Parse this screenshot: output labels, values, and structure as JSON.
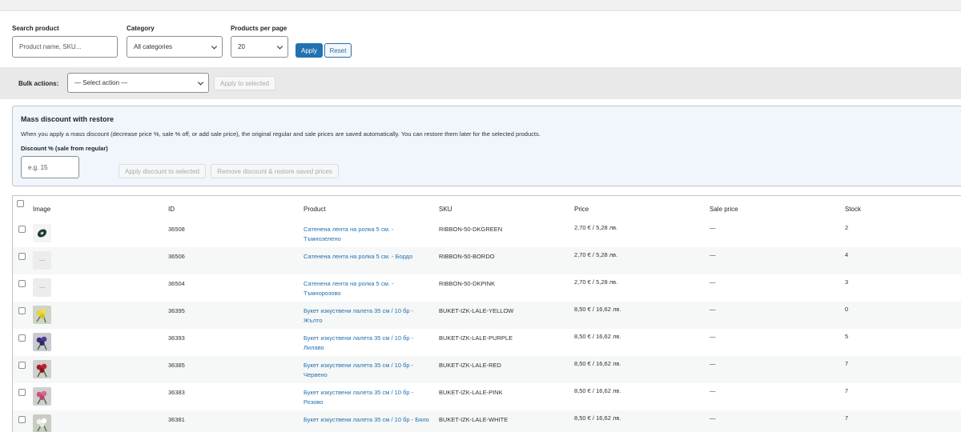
{
  "filters": {
    "search_label": "Search product",
    "search_placeholder": "Product name, SKU...",
    "category_label": "Category",
    "category_value": "All categories",
    "per_page_label": "Products per page",
    "per_page_value": "20",
    "apply_label": "Apply",
    "reset_label": "Reset"
  },
  "bulk": {
    "label": "Bulk actions:",
    "select_value": "— Select action —",
    "apply_label": "Apply to selected"
  },
  "discount": {
    "title": "Mass discount with restore",
    "description": "When you apply a mass discount (decrease price %, sale % off, or add sale price), the original regular and sale prices are saved automatically. You can restore them later for the selected products.",
    "field_label": "Discount % (sale from regular)",
    "field_placeholder": "e.g. 15",
    "apply_label": "Apply discount to selected",
    "remove_label": "Remove discount & restore saved prices"
  },
  "table": {
    "columns": [
      "Image",
      "ID",
      "Product",
      "SKU",
      "Price",
      "Sale price",
      "Stock"
    ],
    "rows": [
      {
        "thumb": "ribbon-dkgreen-thumb",
        "id": "36508",
        "product": "Сатенена лента на ролка 5 см. - Тъмнозелено",
        "sku": "RIBBON-50-DKGREEN",
        "price": "2,70 € / 5,28 лв.",
        "sale": "—",
        "stock": "2"
      },
      {
        "thumb": "placeholder-thumb",
        "id": "36506",
        "product": "Сатенена лента на ролка 5 см. - Бордо",
        "sku": "RIBBON-50-BORDO",
        "price": "2,70 € / 5,28 лв.",
        "sale": "—",
        "stock": "4"
      },
      {
        "thumb": "placeholder-thumb",
        "id": "36504",
        "product": "Сатенена лента на ролка 5 см. - Тъмнорозово",
        "sku": "RIBBON-50-DKPINK",
        "price": "2,70 € / 5,28 лв.",
        "sale": "—",
        "stock": "3"
      },
      {
        "thumb": "tulip-yellow-thumb",
        "id": "36395",
        "product": "Букет изкуствени лалета 35 см / 10 бр - Жълто",
        "sku": "BUKET-IZK-LALE-YELLOW",
        "price": "8,50 € / 16,62 лв.",
        "sale": "—",
        "stock": "0"
      },
      {
        "thumb": "tulip-purple-thumb",
        "id": "36393",
        "product": "Букет изкуствени лалета 35 см / 10 бр - Лилаво",
        "sku": "BUKET-IZK-LALE-PURPLE",
        "price": "8,50 € / 16,62 лв.",
        "sale": "—",
        "stock": "5"
      },
      {
        "thumb": "tulip-red-thumb",
        "id": "36385",
        "product": "Букет изкуствени лалета 35 см / 10 бр - Червено",
        "sku": "BUKET-IZK-LALE-RED",
        "price": "8,50 € / 16,62 лв.",
        "sale": "—",
        "stock": "7"
      },
      {
        "thumb": "tulip-pink-thumb",
        "id": "36383",
        "product": "Букет изкуствени лалета 35 см / 10 бр - Розово",
        "sku": "BUKET-IZK-LALE-PINK",
        "price": "8,50 € / 16,62 лв.",
        "sale": "—",
        "stock": "7"
      },
      {
        "thumb": "tulip-white-thumb",
        "id": "36381",
        "product": "Букет изкуствени лалета 35 см / 10 бр - Бяло",
        "sku": "BUKET-IZK-LALE-WHITE",
        "price": "8,50 € / 16,62 лв.",
        "sale": "—",
        "stock": "7"
      }
    ]
  },
  "colors": {
    "accent": "#2271b1",
    "link": "#2271b1",
    "alt_row": "#f6f7f7",
    "notice_bg": "#f0f6fc"
  }
}
